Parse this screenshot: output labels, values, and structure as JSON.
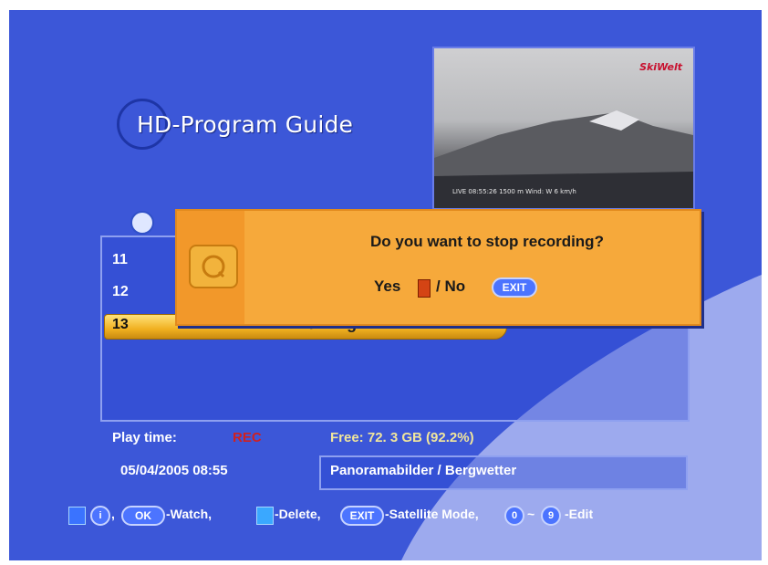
{
  "header": {
    "title": "HD-Program Guide"
  },
  "preview": {
    "logo": "SkiWelt",
    "overlay": "LIVE 08:55:26   1500 m  Wind: W 6 km/h"
  },
  "list": {
    "rows": [
      {
        "num": "11"
      },
      {
        "num": "12"
      },
      {
        "num": "13",
        "title": "Panoramabilder / Bergwetter",
        "status": "REC"
      }
    ]
  },
  "dialog": {
    "message": "Do you want to stop recording?",
    "yes_label": "Yes",
    "no_label": "/ No",
    "exit_key": "EXIT"
  },
  "info": {
    "play_time_label": "Play time:",
    "play_time_value": "REC",
    "free_label": "Free: 72. 3 GB (92.2%)",
    "datetime": "05/04/2005 08:55",
    "program": "Panoramabilder / Bergwetter"
  },
  "footer": {
    "ok_key": "OK",
    "watch": "-Watch,",
    "delete": "-Delete,",
    "exit_key": "EXIT",
    "satellite": "-Satellite Mode,",
    "key_0": "0",
    "tilde": "~",
    "key_9": "9",
    "edit": "-Edit",
    "sep": ","
  },
  "colors": {
    "background": "#3c57d8",
    "dialog": "#f6a93b",
    "highlight_row": "#f0b020",
    "rec_text": "#d02020",
    "key_blue": "#4c74ff"
  }
}
